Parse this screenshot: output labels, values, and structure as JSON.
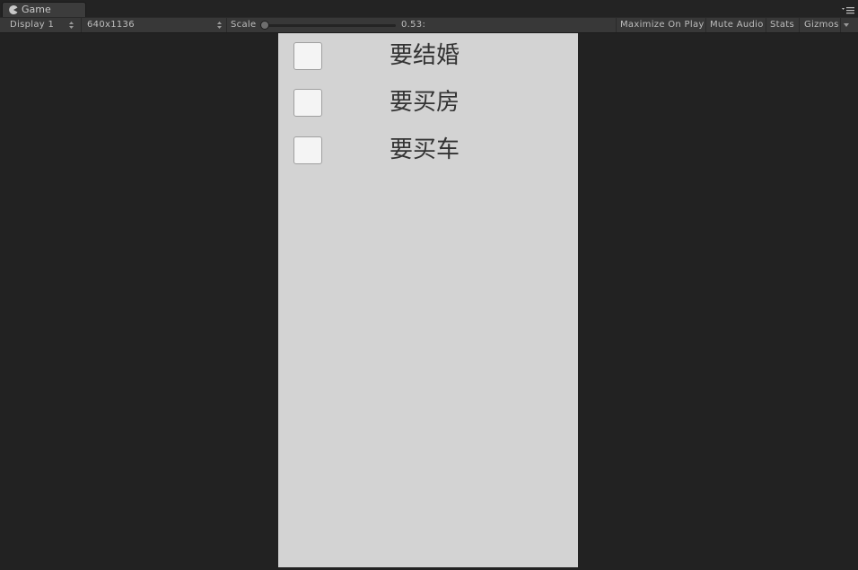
{
  "window": {
    "tab_title": "Game",
    "tab_icon": "pacman-icon",
    "menu_icon": "window-menu-icon"
  },
  "toolbar": {
    "display": "Display 1",
    "resolution": "640x1136",
    "scale_label": "Scale",
    "scale_value": "0.53:",
    "scale_fraction": 0.0,
    "maximize_on_play": "Maximize On Play",
    "mute_audio": "Mute Audio",
    "stats": "Stats",
    "gizmos": "Gizmos"
  },
  "todos": [
    {
      "label": "要结婚",
      "checked": false
    },
    {
      "label": "要买房",
      "checked": false
    },
    {
      "label": "要买车",
      "checked": false
    }
  ],
  "colors": {
    "editor_bg": "#222222",
    "toolbar_bg": "#383838",
    "game_bg": "#d3d3d3",
    "text": "#333333"
  }
}
